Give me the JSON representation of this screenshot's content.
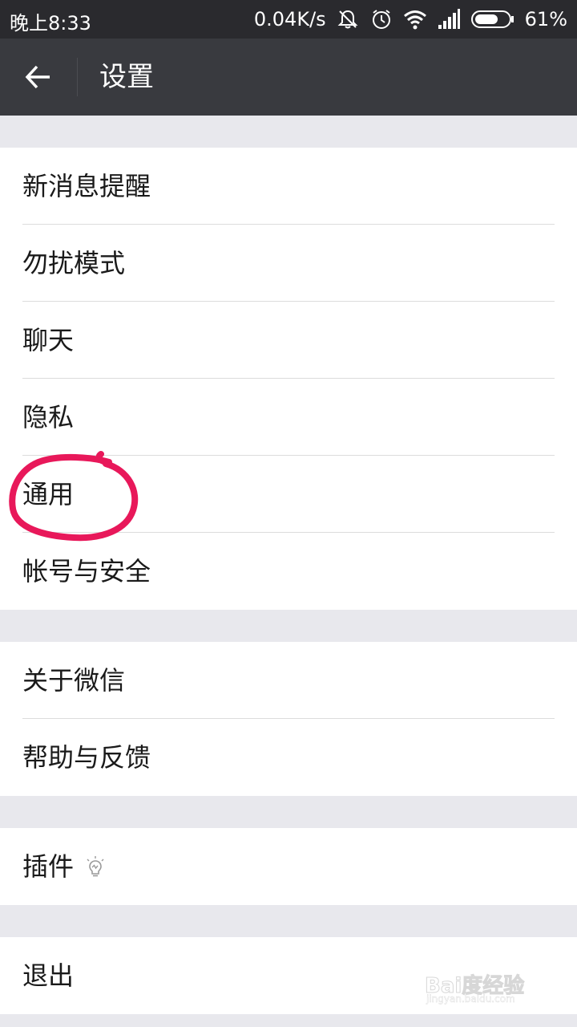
{
  "status_bar": {
    "time": "晚上8:33",
    "net_speed": "0.04K/s",
    "icons": [
      "bell-muted-icon",
      "alarm-icon",
      "wifi-icon",
      "signal-icon",
      "battery-icon"
    ],
    "battery_percent": "61%"
  },
  "header": {
    "back_icon": "back-arrow-icon",
    "title": "设置"
  },
  "groups": [
    {
      "items": [
        {
          "label": "新消息提醒"
        },
        {
          "label": "勿扰模式"
        },
        {
          "label": "聊天"
        },
        {
          "label": "隐私"
        },
        {
          "label": "通用"
        },
        {
          "label": "帐号与安全"
        }
      ]
    },
    {
      "items": [
        {
          "label": "关于微信"
        },
        {
          "label": "帮助与反馈"
        }
      ]
    },
    {
      "items": [
        {
          "label": "插件",
          "icon": "lightbulb-icon"
        }
      ]
    },
    {
      "items": [
        {
          "label": "退出"
        }
      ]
    }
  ],
  "annotation": {
    "type": "hand-drawn-circle",
    "target": "通用",
    "color": "#e8185a"
  },
  "watermark": {
    "text": "Bai度经验",
    "url": "jingyan.baidu.com"
  },
  "colors": {
    "status_bar_bg": "#2a2a2e",
    "header_bg": "#393a3f",
    "page_bg": "#e8e8ed",
    "row_bg": "#ffffff"
  }
}
